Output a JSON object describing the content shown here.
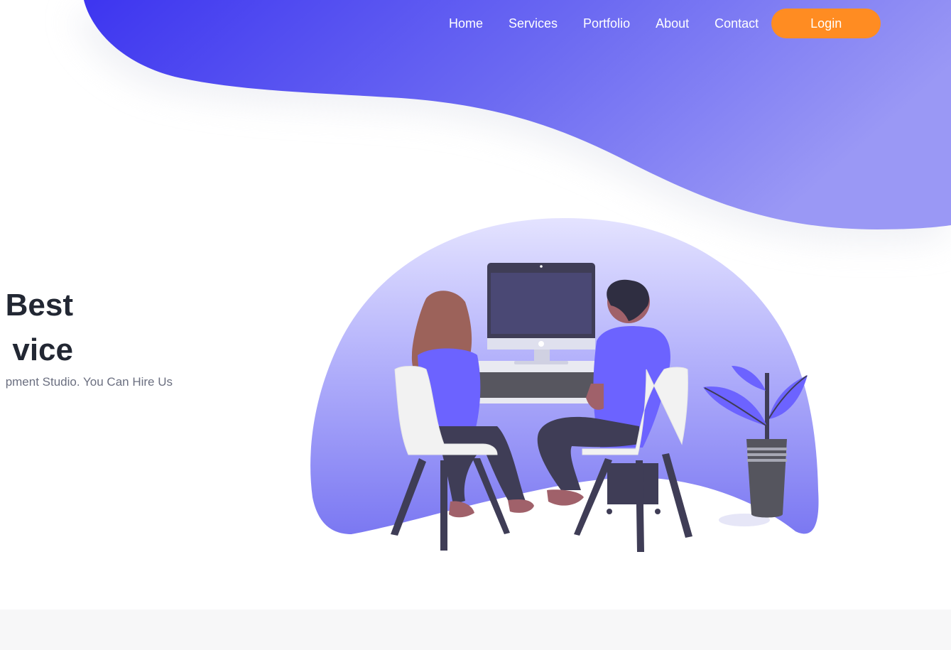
{
  "nav": {
    "items": [
      {
        "label": "Home"
      },
      {
        "label": "Services"
      },
      {
        "label": "Portfolio"
      },
      {
        "label": "About"
      },
      {
        "label": "Contact"
      }
    ],
    "login_label": "Login"
  },
  "hero": {
    "title_line1": "Best",
    "title_line2": "vice",
    "subtitle": "pment Studio. You Can Hire Us"
  },
  "colors": {
    "accent": "#ff8c22",
    "wave_start": "#3d35f0",
    "wave_end": "#9090f4",
    "text_dark": "#222733",
    "text_muted": "#6b6f80"
  },
  "icons": {
    "illustration": "two-people-at-computer-illustration"
  }
}
